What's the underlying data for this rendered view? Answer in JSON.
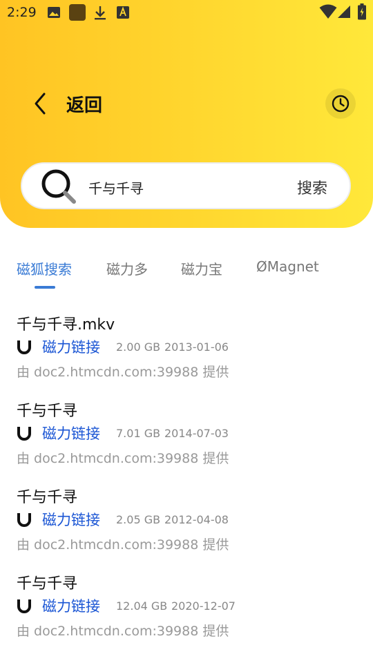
{
  "status_bar": {
    "time": "2:29",
    "icons": [
      "image-icon",
      "app-icon",
      "download-icon",
      "text-icon",
      "wifi-icon",
      "signal-icon",
      "battery-icon"
    ]
  },
  "header": {
    "back_label": "返回",
    "history_icon": "clock-icon",
    "colors": {
      "gradient_start": "#ffc423",
      "gradient_end": "#ffe83a"
    }
  },
  "search": {
    "query": "千与千寻",
    "button_label": "搜索"
  },
  "tabs": [
    {
      "label": "磁狐搜索",
      "active": true
    },
    {
      "label": "磁力多",
      "active": false
    },
    {
      "label": "磁力宝",
      "active": false
    },
    {
      "label": "ØMagnet",
      "active": false
    }
  ],
  "accent_color": "#3a7bd5",
  "link_color": "#1a55d4",
  "results": [
    {
      "title": "千与千寻.mkv",
      "link_label": "磁力链接",
      "size": "2.00 GB",
      "date": "2013-01-06",
      "source": "由 doc2.htmcdn.com:39988 提供"
    },
    {
      "title": "千与千寻",
      "link_label": "磁力链接",
      "size": "7.01 GB",
      "date": "2014-07-03",
      "source": "由 doc2.htmcdn.com:39988 提供"
    },
    {
      "title": "千与千寻",
      "link_label": "磁力链接",
      "size": "2.05 GB",
      "date": "2012-04-08",
      "source": "由 doc2.htmcdn.com:39988 提供"
    },
    {
      "title": "千与千寻",
      "link_label": "磁力链接",
      "size": "12.04 GB",
      "date": "2020-12-07",
      "source": "由 doc2.htmcdn.com:39988 提供"
    }
  ]
}
